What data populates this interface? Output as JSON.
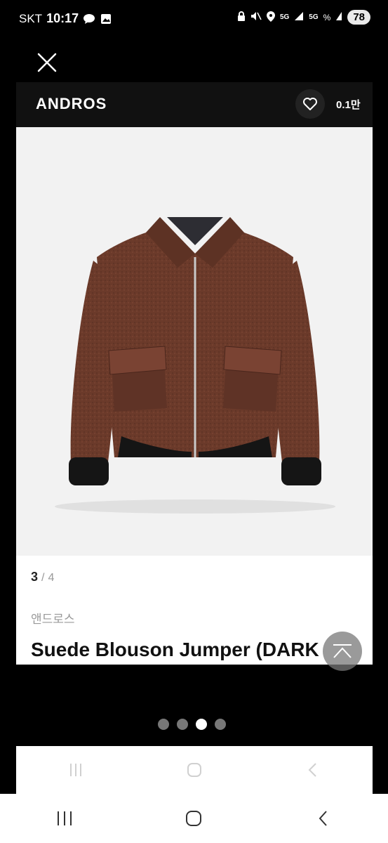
{
  "status_bar": {
    "carrier": "SKT",
    "time": "10:17",
    "battery": "78",
    "network_1": "5G",
    "network_2": "5G",
    "signal_percent": "%"
  },
  "product": {
    "brand_en": "ANDROS",
    "like_count": "0.1만",
    "pager_current": "3",
    "pager_separator": "/",
    "pager_total": "4",
    "brand_ko": "앤드로스",
    "title": "Suede Blouson Jumper (DARK"
  },
  "carousel": {
    "dots": 4,
    "active_index": 2
  },
  "colors": {
    "header_bg": "#111111",
    "jacket": "#6b3a2a",
    "page_bg": "#000000"
  },
  "icons": {
    "close": "close-icon",
    "heart": "heart-icon",
    "scroll_top": "scroll-top-icon",
    "recent_apps": "recent-apps-icon",
    "home": "home-icon",
    "back": "back-icon"
  }
}
